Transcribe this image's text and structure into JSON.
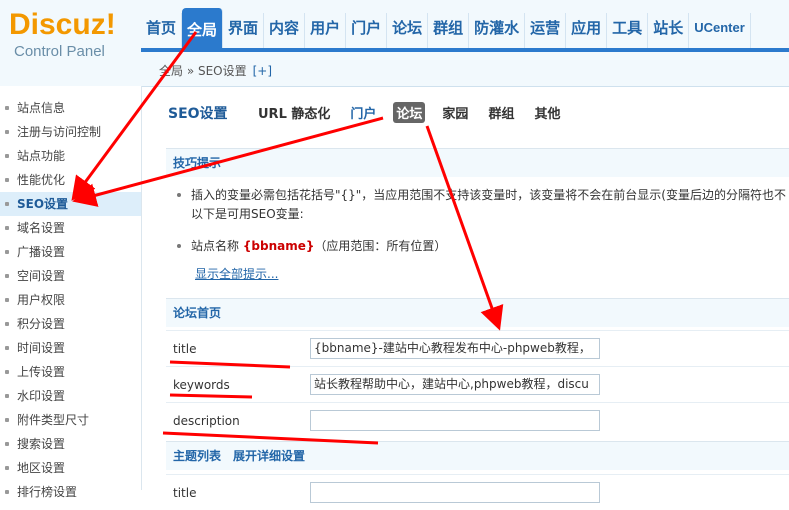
{
  "logo": {
    "brand": "Discuz!",
    "subtitle": "Control Panel"
  },
  "topnav": {
    "items": [
      "首页",
      "全局",
      "界面",
      "内容",
      "用户",
      "门户",
      "论坛",
      "群组",
      "防灌水",
      "运营",
      "应用",
      "工具",
      "站长",
      "UCenter"
    ],
    "active": "全局"
  },
  "breadcrumb": {
    "path": "全局 » SEO设置",
    "add": "[+]"
  },
  "sidebar": {
    "items": [
      "站点信息",
      "注册与访问控制",
      "站点功能",
      "性能优化",
      "SEO设置",
      "域名设置",
      "广播设置",
      "空间设置",
      "用户权限",
      "积分设置",
      "时间设置",
      "上传设置",
      "水印设置",
      "附件类型尺寸",
      "搜索设置",
      "地区设置",
      "排行榜设置"
    ],
    "active": "SEO设置"
  },
  "page": {
    "title": "SEO设置",
    "subtabs": [
      "URL 静态化",
      "门户",
      "论坛",
      "家园",
      "群组",
      "其他"
    ],
    "selected_subtab": "论坛"
  },
  "tips": {
    "heading": "技巧提示",
    "line1": "插入的变量必需包括花括号\"{}\"，当应用范围不支持该变量时，该变量将不会在前台显示(变量后边的分隔符也不",
    "line2": "以下是可用SEO变量:",
    "var_prefix": "站点名称",
    "var_name": "{bbname}",
    "var_scope": "（应用范围：所有位置）",
    "show_all": "显示全部提示..."
  },
  "forum_index": {
    "heading": "论坛首页",
    "fields": [
      {
        "label": "title",
        "value": "{bbname}-建站中心教程发布中心-phpweb教程，"
      },
      {
        "label": "keywords",
        "value": "站长教程帮助中心，建站中心,phpweb教程，discu"
      },
      {
        "label": "description",
        "value": ""
      }
    ]
  },
  "thread_list": {
    "heading": "主题列表",
    "expand_link": "展开详细设置",
    "first_label": "title"
  },
  "colors": {
    "accent": "#2b7acd",
    "logo_orange": "#f39800",
    "arrow": "#ff0000"
  }
}
